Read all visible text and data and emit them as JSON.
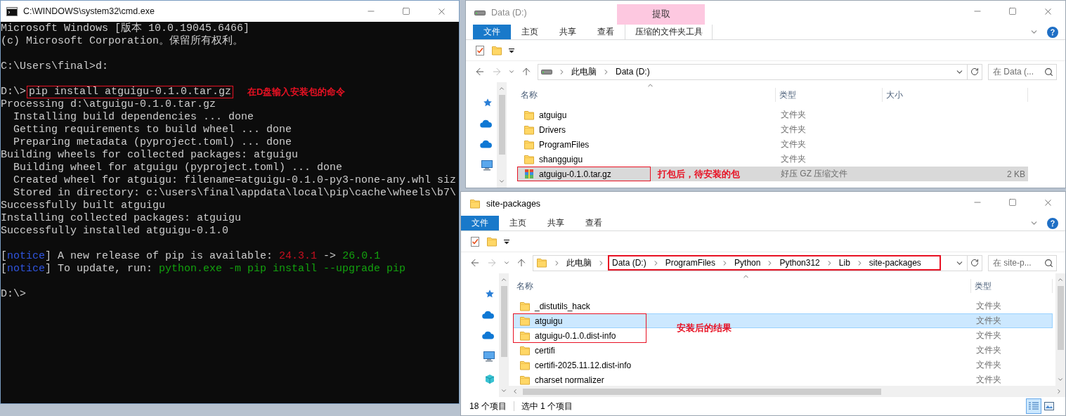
{
  "console_window": {
    "title": "C:\\WINDOWS\\system32\\cmd.exe",
    "lines": [
      {
        "kind": "text",
        "segments": [
          {
            "text": "Microsoft Windows [版本 10.0.19045.6466]"
          }
        ]
      },
      {
        "kind": "text",
        "segments": [
          {
            "text": "(c) Microsoft Corporation。保留所有权利。"
          }
        ]
      },
      {
        "kind": "blank"
      },
      {
        "kind": "text",
        "segments": [
          {
            "text": "C:\\Users\\final>d:"
          }
        ]
      },
      {
        "kind": "blank"
      },
      {
        "kind": "text",
        "segments": [
          {
            "text": "D:\\>",
            "boxed": false
          },
          {
            "text": "pip install atguigu-0.1.0.tar.gz",
            "boxed": true
          }
        ],
        "note": "在D盘输入安装包的命令"
      },
      {
        "kind": "text",
        "segments": [
          {
            "text": "Processing d:\\atguigu-0.1.0.tar.gz"
          }
        ]
      },
      {
        "kind": "text",
        "segments": [
          {
            "text": "  Installing build dependencies ... done"
          }
        ]
      },
      {
        "kind": "text",
        "segments": [
          {
            "text": "  Getting requirements to build wheel ... done"
          }
        ]
      },
      {
        "kind": "text",
        "segments": [
          {
            "text": "  Preparing metadata (pyproject.toml) ... done"
          }
        ]
      },
      {
        "kind": "text",
        "segments": [
          {
            "text": "Building wheels for collected packages: atguigu"
          }
        ]
      },
      {
        "kind": "text",
        "segments": [
          {
            "text": "  Building wheel for atguigu (pyproject.toml) ... done"
          }
        ]
      },
      {
        "kind": "text",
        "segments": [
          {
            "text": "  Created wheel for atguigu: filename=atguigu-0.1.0-py3-none-any.whl siz"
          }
        ]
      },
      {
        "kind": "text",
        "segments": [
          {
            "text": "  Stored in directory: c:\\users\\final\\appdata\\local\\pip\\cache\\wheels\\b7\\"
          }
        ]
      },
      {
        "kind": "text",
        "segments": [
          {
            "text": "Successfully built atguigu"
          }
        ]
      },
      {
        "kind": "text",
        "segments": [
          {
            "text": "Installing collected packages: atguigu"
          }
        ]
      },
      {
        "kind": "text",
        "segments": [
          {
            "text": "Successfully installed atguigu-0.1.0"
          }
        ]
      },
      {
        "kind": "blank"
      },
      {
        "kind": "text",
        "segments": [
          {
            "text": "["
          },
          {
            "text": "notice",
            "color": "#2f55e0"
          },
          {
            "text": "] A new release of pip is available: "
          },
          {
            "text": "24.3.1",
            "color": "#c50f1f"
          },
          {
            "text": " -> "
          },
          {
            "text": "26.0.1",
            "color": "#13a10e"
          }
        ]
      },
      {
        "kind": "text",
        "segments": [
          {
            "text": "["
          },
          {
            "text": "notice",
            "color": "#2f55e0"
          },
          {
            "text": "] To update, run: "
          },
          {
            "text": "python.exe -m pip install --upgrade pip",
            "color": "#13a10e"
          }
        ]
      },
      {
        "kind": "blank"
      },
      {
        "kind": "text",
        "segments": [
          {
            "text": "D:\\>"
          }
        ]
      }
    ]
  },
  "explorer_windows": [
    {
      "title": "Data (D:)",
      "kind": "drive",
      "active": false,
      "ribbon": {
        "context_group": "提取",
        "tabs": [
          {
            "label": "文件",
            "kind": "file"
          },
          {
            "label": "主页",
            "kind": "tab"
          },
          {
            "label": "共享",
            "kind": "tab"
          },
          {
            "label": "查看",
            "kind": "tab"
          },
          {
            "label": "压缩的文件夹工具",
            "kind": "context"
          }
        ]
      },
      "address": {
        "crumbs": [
          "此电脑",
          "Data (D:)"
        ]
      },
      "search": {
        "placeholder": "在 Data (..."
      },
      "columns": [
        {
          "label": "名称"
        },
        {
          "label": "类型"
        },
        {
          "label": "大小"
        }
      ],
      "rows": [
        {
          "name": "atguigu",
          "kind": "folder",
          "type": "文件夹",
          "selected": false,
          "boxed": false
        },
        {
          "name": "Drivers",
          "kind": "folder",
          "type": "文件夹",
          "selected": false,
          "boxed": false
        },
        {
          "name": "ProgramFiles",
          "kind": "folder",
          "type": "文件夹",
          "selected": false,
          "boxed": false
        },
        {
          "name": "shangguigu",
          "kind": "folder",
          "type": "文件夹",
          "selected": false,
          "boxed": false
        },
        {
          "name": "atguigu-0.1.0.tar.gz",
          "kind": "archive",
          "type": "好压 GZ 压缩文件",
          "size": "2 KB",
          "selected": true,
          "boxed": true
        }
      ],
      "note": "打包后，待安装的包"
    },
    {
      "title": "site-packages",
      "kind": "folder",
      "active": true,
      "ribbon": {
        "tabs": [
          {
            "label": "文件",
            "kind": "file"
          },
          {
            "label": "主页",
            "kind": "tab"
          },
          {
            "label": "共享",
            "kind": "tab"
          },
          {
            "label": "查看",
            "kind": "tab"
          }
        ]
      },
      "address": {
        "crumbs": [
          "此电脑"
        ],
        "highlighted_crumbs": [
          "Data (D:)",
          "ProgramFiles",
          "Python",
          "Python312",
          "Lib",
          "site-packages"
        ]
      },
      "search": {
        "placeholder": "在 site-p..."
      },
      "columns": [
        {
          "label": "名称"
        },
        {
          "label": "类型"
        }
      ],
      "rows": [
        {
          "name": "_distutils_hack",
          "kind": "folder",
          "type": "文件夹",
          "selected": false,
          "boxed": false
        },
        {
          "name": "atguigu",
          "kind": "folder",
          "type": "文件夹",
          "selected": true,
          "boxed": true
        },
        {
          "name": "atguigu-0.1.0.dist-info",
          "kind": "folder",
          "type": "文件夹",
          "selected": false,
          "boxed": true
        },
        {
          "name": "certifi",
          "kind": "folder",
          "type": "文件夹",
          "selected": false,
          "boxed": false
        },
        {
          "name": "certifi-2025.11.12.dist-info",
          "kind": "folder",
          "type": "文件夹",
          "selected": false,
          "boxed": false
        },
        {
          "name": "charset normalizer",
          "kind": "folder",
          "type": "文件夹",
          "selected": false,
          "boxed": false
        }
      ],
      "note": "安装后的结果",
      "status": [
        "18 个项目",
        "选中 1 个项目"
      ]
    }
  ]
}
